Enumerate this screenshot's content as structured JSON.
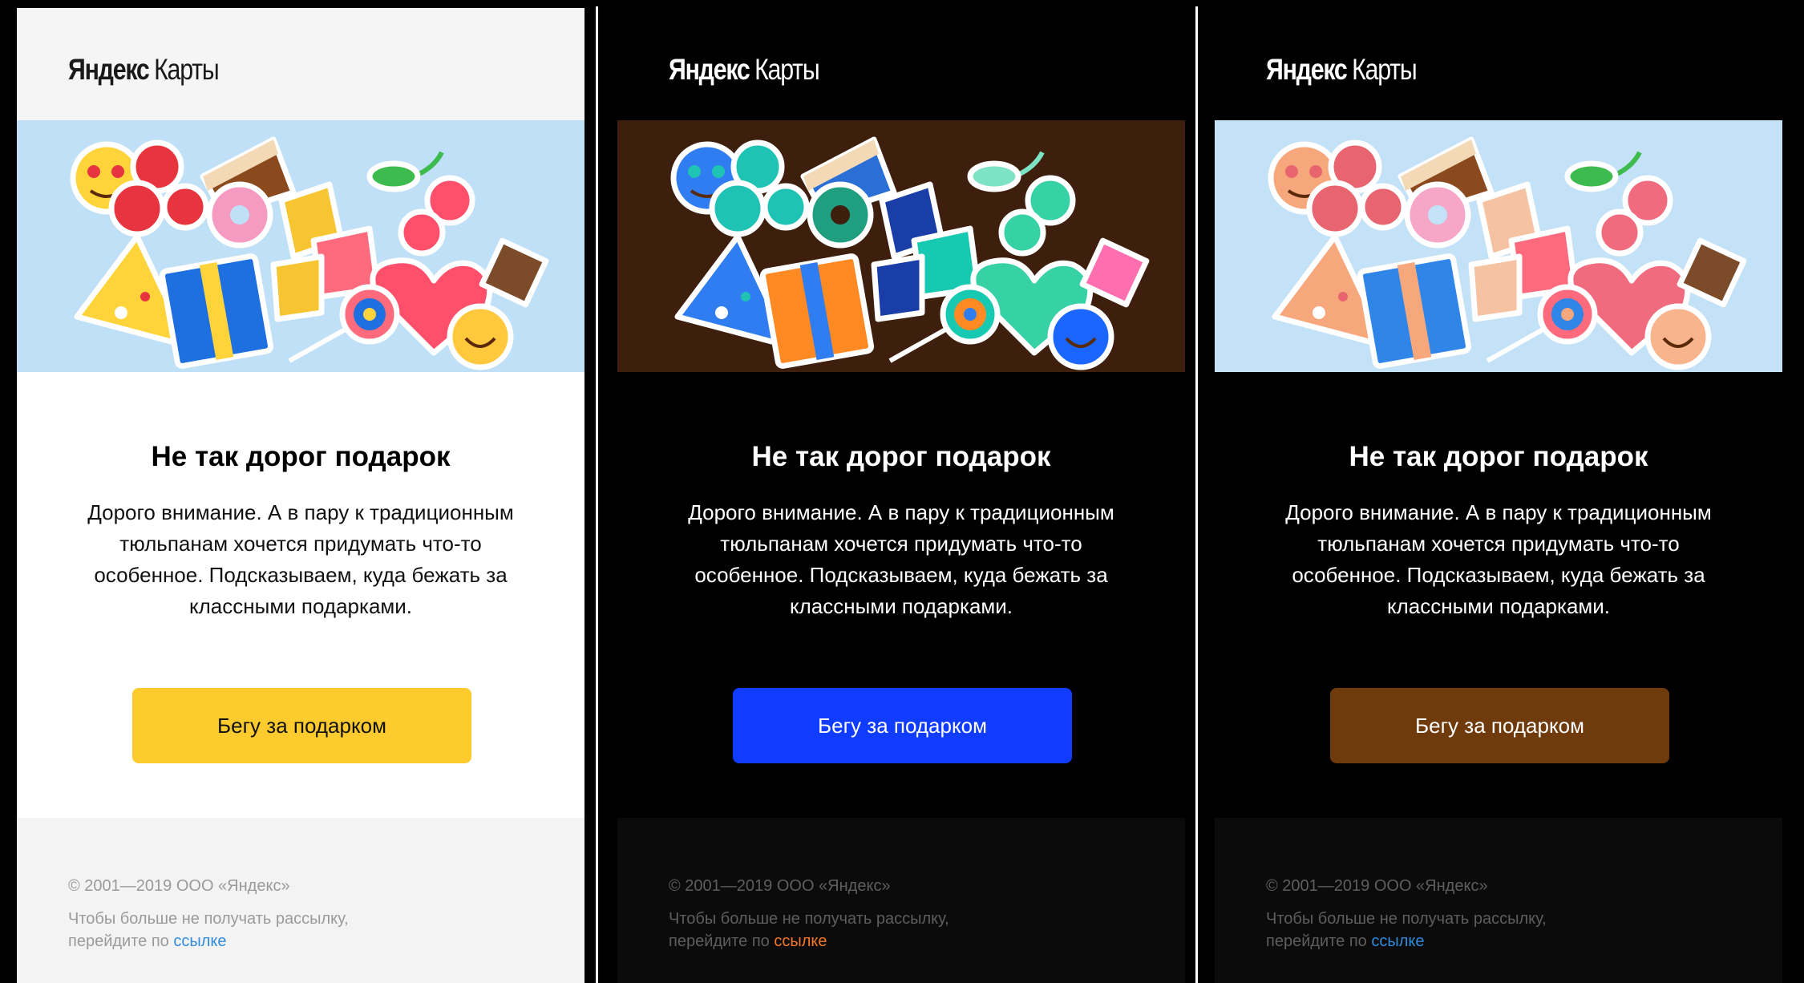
{
  "email": {
    "logo_brand": "Яндекс",
    "logo_product": "Карты",
    "title": "Не так дорог подарок",
    "body": "Дорого внимание. А в пару к традиционным тюльпанам хочется придумать что-то особенное. Подсказываем, куда бежать за классными подарками.",
    "cta_label": "Бегу за подарком",
    "copyright": "© 2001—2019 ООО «Яндекс»",
    "unsubscribe_prefix": "Чтобы больше не получать рассылку, перейдите по",
    "unsubscribe_link": "ссылке"
  },
  "variants": [
    {
      "name": "light",
      "header_bg": "#f5f5f5",
      "logo_color": "#1a1a1a",
      "banner_bg": "#bfe0f6",
      "content_bg": "#ffffff",
      "title_color": "#000000",
      "text_color": "#111111",
      "cta_bg": "#fdcb2e",
      "cta_text": "#111111",
      "footer_bg": "#f3f3f3",
      "footer_text": "#9a9a9a",
      "link_color": "#2f8bdc"
    },
    {
      "name": "dark",
      "header_bg": "#000000",
      "logo_color": "#ffffff",
      "banner_bg": "#3e1f0d",
      "content_bg": "#000000",
      "title_color": "#ffffff",
      "text_color": "#ffffff",
      "cta_bg": "#0f3cff",
      "cta_text": "#ffffff",
      "footer_bg": "#0b0b0b",
      "footer_text": "#5e5e5e",
      "link_color": "#f5782a"
    },
    {
      "name": "dark-adapted",
      "header_bg": "#000000",
      "logo_color": "#ffffff",
      "banner_bg": "#c3e1f7",
      "content_bg": "#000000",
      "title_color": "#ffffff",
      "text_color": "#ffffff",
      "cta_bg": "#6f3a0c",
      "cta_text": "#ffffff",
      "footer_bg": "#0b0b0b",
      "footer_text": "#5e5e5e",
      "link_color": "#2f8bdc"
    }
  ]
}
